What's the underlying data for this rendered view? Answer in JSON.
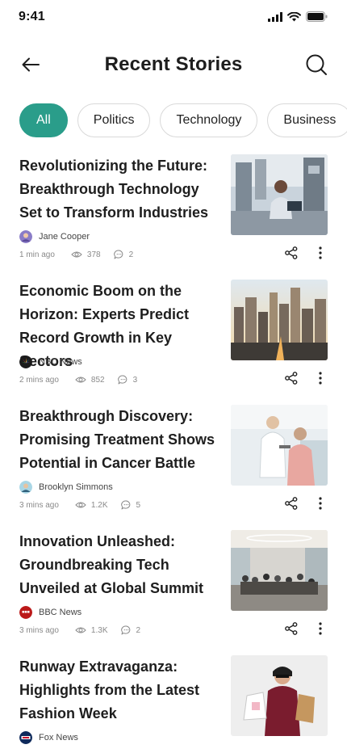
{
  "status_bar": {
    "time": "9:41"
  },
  "header": {
    "title": "Recent Stories"
  },
  "tabs": [
    {
      "label": "All",
      "active": true
    },
    {
      "label": "Politics",
      "active": false
    },
    {
      "label": "Technology",
      "active": false
    },
    {
      "label": "Business",
      "active": false
    }
  ],
  "stories": [
    {
      "title": "Revolutionizing the Future: Breakthrough Technology Set to Transform Industries",
      "author": "Jane Cooper",
      "time": "1 min ago",
      "views": "378",
      "comments": "2"
    },
    {
      "title": "Economic Boom on the Horizon: Experts Predict Record Growth in Key Sectors",
      "author": "NBC News",
      "time": "2 mins ago",
      "views": "852",
      "comments": "3"
    },
    {
      "title": "Breakthrough Discovery: Promising Treatment Shows Potential in Cancer Battle",
      "author": "Brooklyn Simmons",
      "time": "3 mins ago",
      "views": "1.2K",
      "comments": "5"
    },
    {
      "title": "Innovation Unleashed: Groundbreaking Tech Unveiled at Global Summit",
      "author": "BBC News",
      "time": "3 mins ago",
      "views": "1.3K",
      "comments": "2"
    },
    {
      "title": "Runway Extravaganza: Highlights from the Latest Fashion Week",
      "author": "Fox News",
      "time": "",
      "views": "",
      "comments": ""
    }
  ],
  "colors": {
    "accent": "#2a9d8a",
    "text": "#1e1e1e",
    "muted": "#8a8a8a"
  },
  "icons": [
    "back-arrow-icon",
    "search-icon",
    "eye-icon",
    "comment-icon",
    "share-icon",
    "more-vertical-icon"
  ]
}
